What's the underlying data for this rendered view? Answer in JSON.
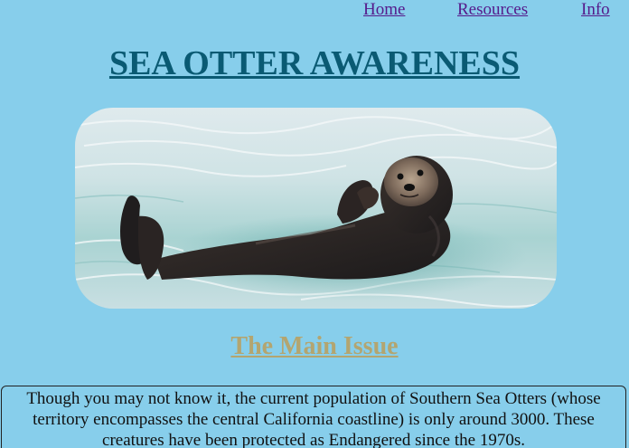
{
  "nav": {
    "home": "Home",
    "resources": "Resources",
    "info": "Info"
  },
  "header": {
    "title": "SEA OTTER AWARENESS"
  },
  "hero": {
    "alt": "Sea otter floating on its back in the water"
  },
  "main": {
    "heading": "The Main Issue",
    "paragraph": "Though you may not know it, the current population of Southern Sea Otters (whose territory encompasses the central California coastline) is only around 3000. These creatures have been protected as Endangered since the 1970s."
  },
  "colors": {
    "background": "#87ceeb",
    "title": "#0a5a73",
    "link": "#551a8b",
    "heading": "#b3a570"
  }
}
